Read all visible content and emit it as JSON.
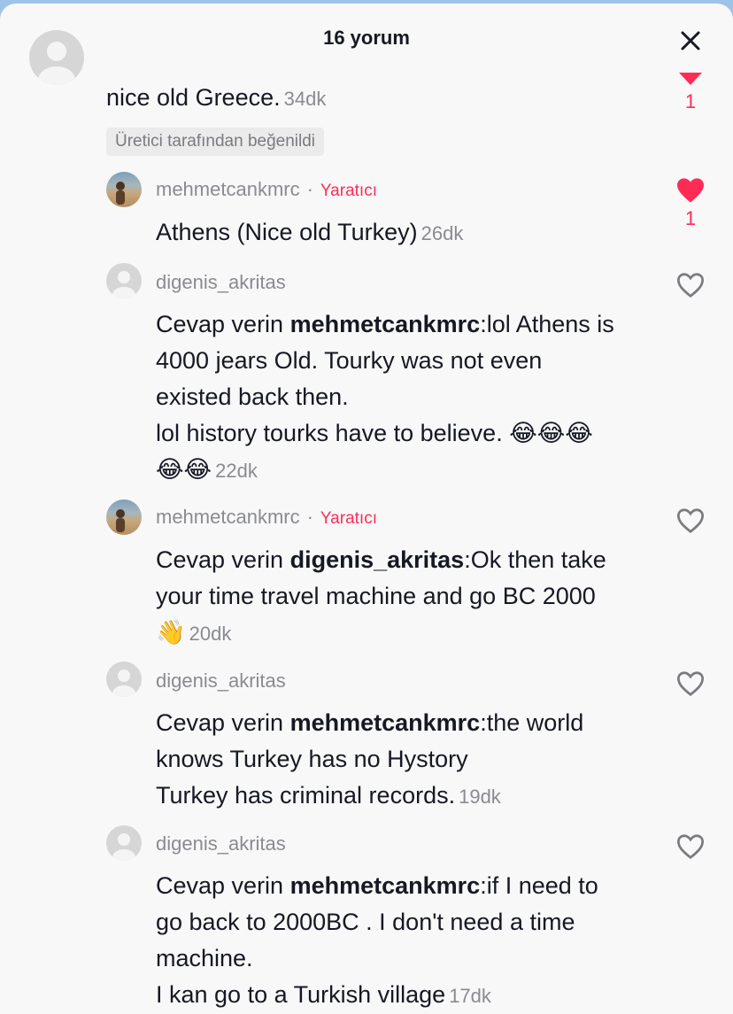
{
  "header": {
    "title": "16 yorum",
    "close_label": "×"
  },
  "top_comment": {
    "text": "nice old Greece.",
    "time": "34dk",
    "badge": "Üretici tarafından beğenildi",
    "like_count": "1"
  },
  "replies": [
    {
      "username": "mehmetcankmrc",
      "creator_label": "Yaratıcı",
      "text": "Athens (Nice old Turkey)",
      "time": "26dk",
      "liked": true,
      "like_count": "1"
    },
    {
      "username": "digenis_akritas",
      "reply_prefix": "Cevap verin",
      "mention": "mehmetcankmrc",
      "text_lines": [
        ":lol Athens is",
        "4000 jears Old. Tourky was not even",
        "existed back then.",
        "lol history tourks have to believe. 😂😂😂",
        "😂😂"
      ],
      "time": "22dk"
    },
    {
      "username": "mehmetcankmrc",
      "creator_label": "Yaratıcı",
      "reply_prefix": "Cevap verin",
      "mention": "digenis_akritas",
      "text_lines": [
        ":Ok then take",
        "your time travel machine and go BC 2000",
        "👋"
      ],
      "time": "20dk"
    },
    {
      "username": "digenis_akritas",
      "reply_prefix": "Cevap verin",
      "mention": "mehmetcankmrc",
      "text_lines": [
        ":the world",
        "knows Turkey has no Hystory",
        "Turkey has criminal records."
      ],
      "time": "19dk"
    },
    {
      "username": "digenis_akritas",
      "reply_prefix": "Cevap verin",
      "mention": "mehmetcankmrc",
      "text_lines": [
        ":if I need to",
        "go back to 2000BC . I don't need a time",
        "machine.",
        "I kan go to a Turkish village"
      ],
      "time": "17dk"
    }
  ],
  "colors": {
    "accent": "#fe2c55",
    "muted_text": "#8a8b91",
    "text": "#161823"
  }
}
